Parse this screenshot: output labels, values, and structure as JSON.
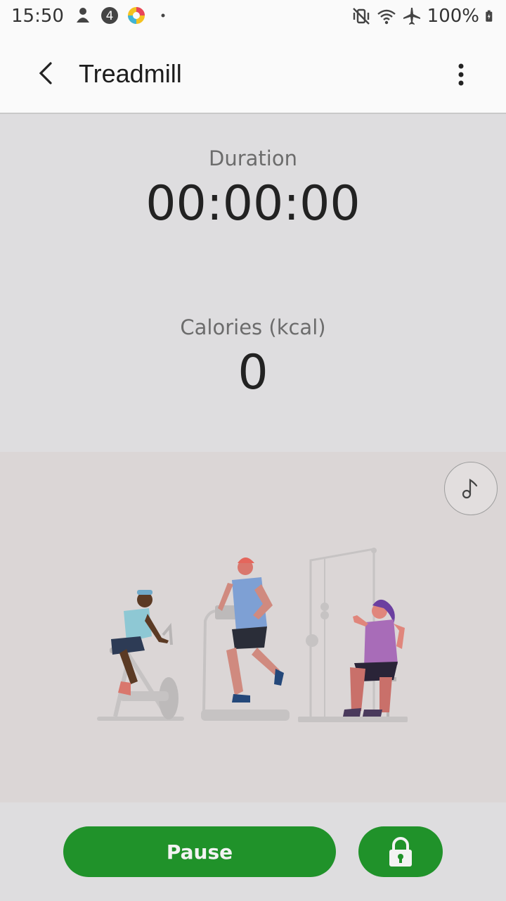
{
  "status_bar": {
    "time": "15:50",
    "battery": "100%",
    "icons": [
      "notification-icon",
      "badge-4-icon",
      "app-icon",
      "dot-icon",
      "vibrate-icon",
      "wifi-icon",
      "airplane-icon",
      "battery-charging-icon"
    ]
  },
  "header": {
    "title": "Treadmill",
    "back_icon": "back-arrow-icon",
    "more_icon": "more-vert-icon"
  },
  "stats": {
    "duration_label": "Duration",
    "duration_value": "00:00:00",
    "calories_label": "Calories (kcal)",
    "calories_value": "0"
  },
  "illustration": {
    "music_icon": "music-note-icon"
  },
  "controls": {
    "pause_label": "Pause",
    "lock_icon": "lock-icon",
    "accent": "#20922a"
  }
}
